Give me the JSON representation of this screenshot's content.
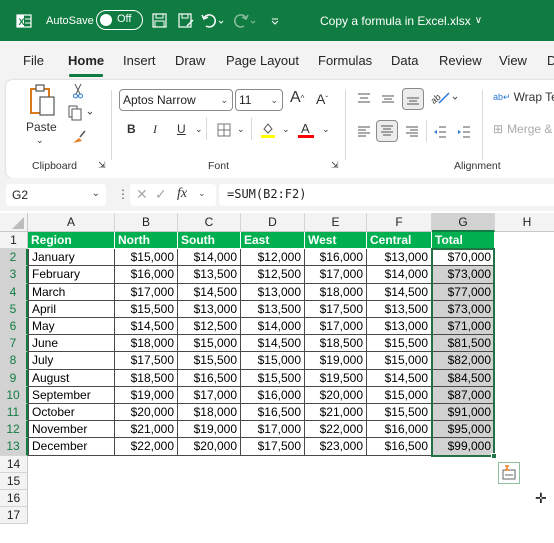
{
  "titlebar": {
    "app_icon": "excel-logo-icon",
    "autosave_label": "AutoSave",
    "autosave_state": "Off",
    "save_icon": "save-icon",
    "save_as_icon": "save-as-icon",
    "undo_icon": "undo-icon",
    "redo_icon": "redo-icon",
    "customize_icon": "customize-quick-access-icon",
    "document_title": "Copy a formula in Excel.xlsx",
    "title_chevron": "∨"
  },
  "tabs": [
    {
      "label": "File"
    },
    {
      "label": "Home",
      "active": true
    },
    {
      "label": "Insert"
    },
    {
      "label": "Draw"
    },
    {
      "label": "Page Layout"
    },
    {
      "label": "Formulas"
    },
    {
      "label": "Data"
    },
    {
      "label": "Review"
    },
    {
      "label": "View"
    },
    {
      "label": "D"
    }
  ],
  "ribbon": {
    "clipboard": {
      "label": "Clipboard",
      "paste_label": "Paste"
    },
    "font": {
      "label": "Font",
      "font_name": "Aptos Narrow",
      "font_size": "11",
      "bold": "B",
      "italic": "I",
      "underline": "U",
      "fill_color": "#ffff00",
      "font_color": "#ff0000",
      "grow": "A",
      "shrink": "A"
    },
    "alignment": {
      "label": "Alignment",
      "wrap_text": "Wrap Te",
      "merge": "Merge &"
    }
  },
  "formula_bar": {
    "name_box": "G2",
    "fx": "fx",
    "formula": "=SUM(B2:F2)"
  },
  "sheet": {
    "columns": [
      "A",
      "B",
      "C",
      "D",
      "E",
      "F",
      "G",
      "H"
    ],
    "selected_column": "G",
    "header_row": [
      "Region",
      "North",
      "South",
      "East",
      "West",
      "Central",
      "Total"
    ],
    "rows": [
      [
        "January",
        "$15,000",
        "$14,000",
        "$12,000",
        "$16,000",
        "$13,000",
        "$70,000"
      ],
      [
        "February",
        "$16,000",
        "$13,500",
        "$12,500",
        "$17,000",
        "$14,000",
        "$73,000"
      ],
      [
        "March",
        "$17,000",
        "$14,500",
        "$13,000",
        "$18,000",
        "$14,500",
        "$77,000"
      ],
      [
        "April",
        "$15,500",
        "$13,000",
        "$13,500",
        "$17,500",
        "$13,500",
        "$73,000"
      ],
      [
        "May",
        "$14,500",
        "$12,500",
        "$14,000",
        "$17,000",
        "$13,000",
        "$71,000"
      ],
      [
        "June",
        "$18,000",
        "$15,000",
        "$14,500",
        "$18,500",
        "$15,500",
        "$81,500"
      ],
      [
        "July",
        "$17,500",
        "$15,500",
        "$15,000",
        "$19,000",
        "$15,000",
        "$82,000"
      ],
      [
        "August",
        "$18,500",
        "$16,500",
        "$15,500",
        "$19,500",
        "$14,500",
        "$84,500"
      ],
      [
        "September",
        "$19,000",
        "$17,000",
        "$16,000",
        "$20,000",
        "$15,000",
        "$87,000"
      ],
      [
        "October",
        "$20,000",
        "$18,000",
        "$16,500",
        "$21,000",
        "$15,500",
        "$91,000"
      ],
      [
        "November",
        "$21,000",
        "$19,000",
        "$17,000",
        "$22,000",
        "$16,000",
        "$95,000"
      ],
      [
        "December",
        "$22,000",
        "$20,000",
        "$17,500",
        "$23,000",
        "$16,500",
        "$99,000"
      ]
    ],
    "row_numbers": [
      "1",
      "2",
      "3",
      "4",
      "5",
      "6",
      "7",
      "8",
      "9",
      "10",
      "11",
      "12",
      "13",
      "14",
      "15",
      "16",
      "17"
    ],
    "header_fill": "#00b050",
    "selection_color": "#217346"
  }
}
